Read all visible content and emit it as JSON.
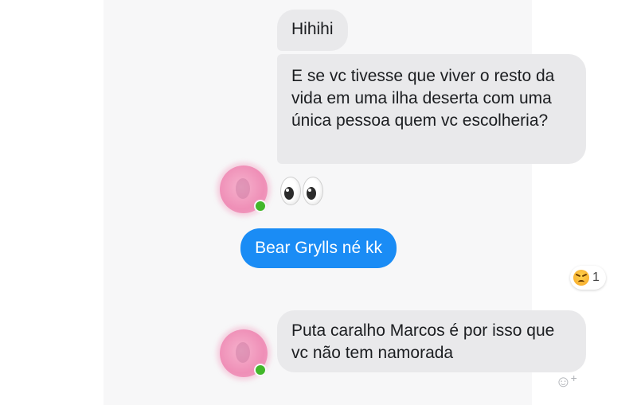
{
  "conversation": {
    "messages": [
      {
        "side": "incoming",
        "text": "Hihihi"
      },
      {
        "side": "incoming",
        "text": "E se vc tivesse que viver o resto da vida em uma ilha deserta com uma única pessoa quem vc escolheria?"
      },
      {
        "side": "incoming",
        "emoji": "eyes-emoji"
      },
      {
        "side": "outgoing",
        "text": "Bear Grylls né kk"
      },
      {
        "side": "incoming",
        "text": "Puta caralho Marcos é por isso que vc não tem namorada"
      }
    ],
    "reaction": {
      "icon": "angry-face-emoji",
      "count": "1"
    },
    "add_reaction_icon": "add-reaction-icon"
  },
  "colors": {
    "outgoing_bubble": "#1a8cf5",
    "incoming_bubble": "#e9e9eb",
    "online_dot": "#42b72a",
    "avatar": "#ef8fb7"
  }
}
